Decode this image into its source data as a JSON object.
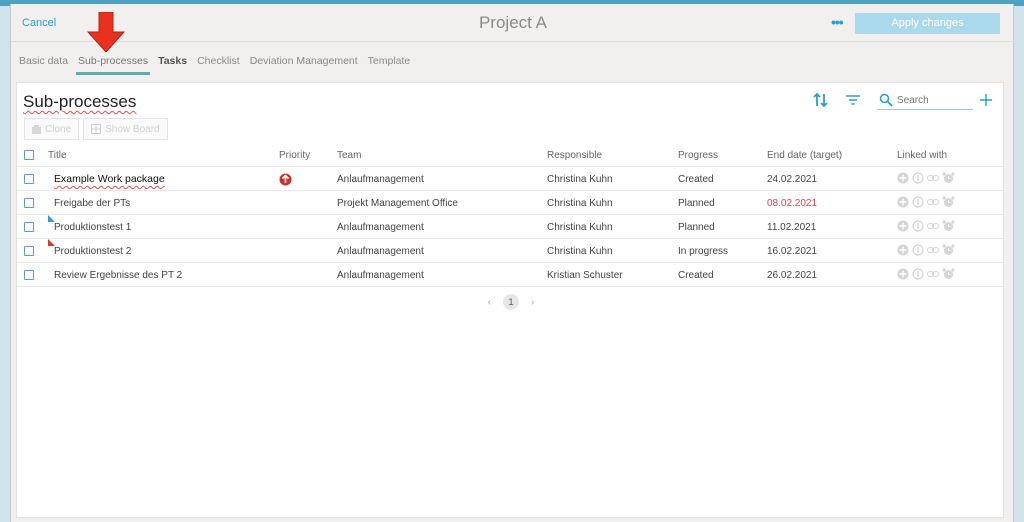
{
  "header": {
    "cancel_label": "Cancel",
    "title": "Project A",
    "more_label": "•••",
    "apply_label": "Apply changes"
  },
  "tabs": [
    {
      "label": "Basic data"
    },
    {
      "label": "Sub-processes"
    },
    {
      "label": "Tasks"
    },
    {
      "label": "Checklist"
    },
    {
      "label": "Deviation Management"
    },
    {
      "label": "Template"
    }
  ],
  "panel": {
    "title": "Sub-processes",
    "search_placeholder": "Search",
    "clone_label": "Clone",
    "show_board_label": "Show Board"
  },
  "columns": {
    "title": "Title",
    "priority": "Priority",
    "team": "Team",
    "responsible": "Responsible",
    "progress": "Progress",
    "end_date": "End date (target)",
    "linked": "Linked with"
  },
  "rows": [
    {
      "title": "Example Work package",
      "team": "Anlaufmanagement",
      "responsible": "Christina Kuhn",
      "progress": "Created",
      "end_date": "24.02.2021"
    },
    {
      "title": "Freigabe der PTs",
      "team": "Projekt Management Office",
      "responsible": "Christina Kuhn",
      "progress": "Planned",
      "end_date": "08.02.2021"
    },
    {
      "title": "Produktionstest 1",
      "team": "Anlaufmanagement",
      "responsible": "Christina Kuhn",
      "progress": "Planned",
      "end_date": "11.02.2021"
    },
    {
      "title": "Produktionstest 2",
      "team": "Anlaufmanagement",
      "responsible": "Christina Kuhn",
      "progress": "In progress",
      "end_date": "16.02.2021"
    },
    {
      "title": "Review Ergebnisse des PT 2",
      "team": "Anlaufmanagement",
      "responsible": "Kristian Schuster",
      "progress": "Created",
      "end_date": "26.02.2021"
    }
  ],
  "pagination": {
    "prev": "‹",
    "current": "1",
    "next": "›"
  },
  "colors": {
    "accent": "#2a9fd6",
    "tab_underline": "#5aaeb2",
    "overdue": "#d64545",
    "flag_blue": "#3a9ad9",
    "flag_red": "#e03a2f",
    "arrow": "#e8321e"
  }
}
